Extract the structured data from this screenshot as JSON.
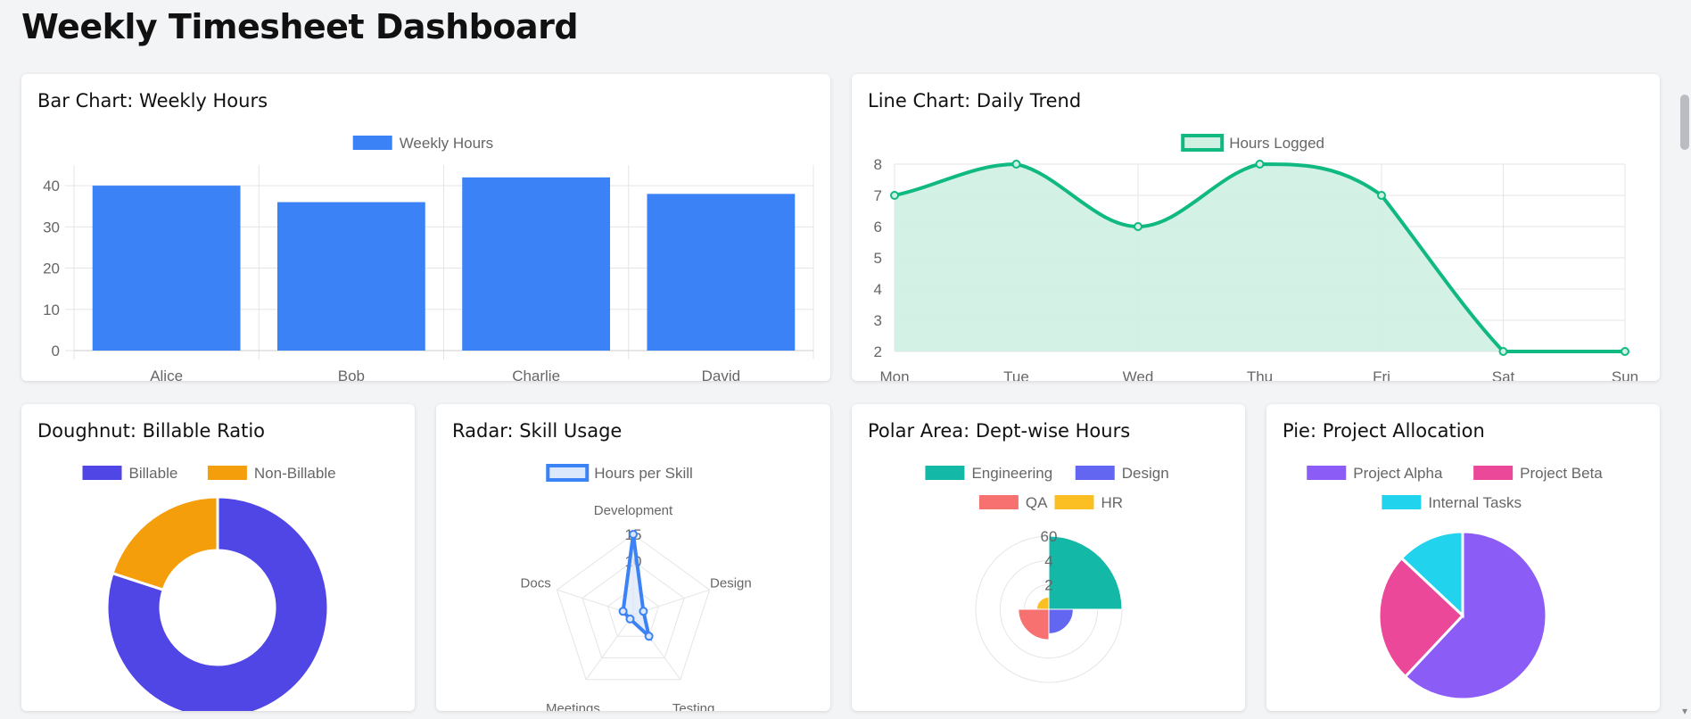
{
  "page": {
    "title": "Weekly Timesheet Dashboard"
  },
  "cards": {
    "bar": {
      "title": "Bar Chart: Weekly Hours"
    },
    "line": {
      "title": "Line Chart: Daily Trend"
    },
    "doughnut": {
      "title": "Doughnut: Billable Ratio"
    },
    "radar": {
      "title": "Radar: Skill Usage"
    },
    "polar": {
      "title": "Polar Area: Dept-wise Hours"
    },
    "pie": {
      "title": "Pie: Project Allocation"
    }
  },
  "scrollbar": {
    "arrow_icon": "chevron-down-icon"
  },
  "chart_data": [
    {
      "id": "bar",
      "type": "bar",
      "title": "Bar Chart: Weekly Hours",
      "categories": [
        "Alice",
        "Bob",
        "Charlie",
        "David"
      ],
      "series": [
        {
          "name": "Weekly Hours",
          "values": [
            40,
            36,
            42,
            38
          ],
          "color": "#3b82f6"
        }
      ],
      "ylim": [
        0,
        45
      ],
      "yticks": [
        0,
        10,
        20,
        30,
        40
      ],
      "grid": true,
      "legend": "top"
    },
    {
      "id": "line",
      "type": "line",
      "title": "Line Chart: Daily Trend",
      "categories": [
        "Mon",
        "Tue",
        "Wed",
        "Thu",
        "Fri",
        "Sat",
        "Sun"
      ],
      "series": [
        {
          "name": "Hours Logged",
          "values": [
            7,
            8,
            6,
            8,
            7,
            2,
            2
          ],
          "color": "#10b981",
          "fill": "#d1f0e4"
        }
      ],
      "ylim": [
        2,
        8
      ],
      "yticks": [
        2,
        3,
        4,
        5,
        6,
        7,
        8
      ],
      "grid": true,
      "legend": "top"
    },
    {
      "id": "doughnut",
      "type": "pie",
      "variant": "doughnut",
      "title": "Doughnut: Billable Ratio",
      "labels": [
        "Billable",
        "Non-Billable"
      ],
      "values": [
        80,
        20
      ],
      "colors": [
        "#4f46e5",
        "#f59e0b"
      ],
      "legend": "top"
    },
    {
      "id": "radar",
      "type": "radar",
      "title": "Radar: Skill Usage",
      "labels": [
        "Development",
        "Design",
        "Testing",
        "Meetings",
        "Docs"
      ],
      "series": [
        {
          "name": "Hours per Skill",
          "values": [
            15,
            2,
            5,
            1,
            2
          ],
          "color": "#3b82f6",
          "fill": "#dbe7fb"
        }
      ],
      "rlim": [
        0,
        15
      ],
      "rticks": [
        5,
        10,
        15
      ],
      "tick_labels": [
        "10",
        "15"
      ],
      "legend": "top"
    },
    {
      "id": "polar",
      "type": "polarArea",
      "title": "Polar Area: Dept-wise Hours",
      "labels": [
        "Engineering",
        "Design",
        "QA",
        "HR"
      ],
      "values": [
        60,
        20,
        25,
        10
      ],
      "colors": [
        "#14b8a6",
        "#6366f1",
        "#f87171",
        "#fbbf24"
      ],
      "rlim": [
        0,
        60
      ],
      "rticks": [
        20,
        40,
        60
      ],
      "tick_labels": [
        "2",
        "4",
        "60"
      ],
      "legend": "top"
    },
    {
      "id": "pie",
      "type": "pie",
      "title": "Pie: Project Allocation",
      "labels": [
        "Project Alpha",
        "Project Beta",
        "Internal Tasks"
      ],
      "values": [
        62,
        25,
        13
      ],
      "colors": [
        "#8b5cf6",
        "#ec4899",
        "#22d3ee"
      ],
      "legend": "top"
    }
  ]
}
